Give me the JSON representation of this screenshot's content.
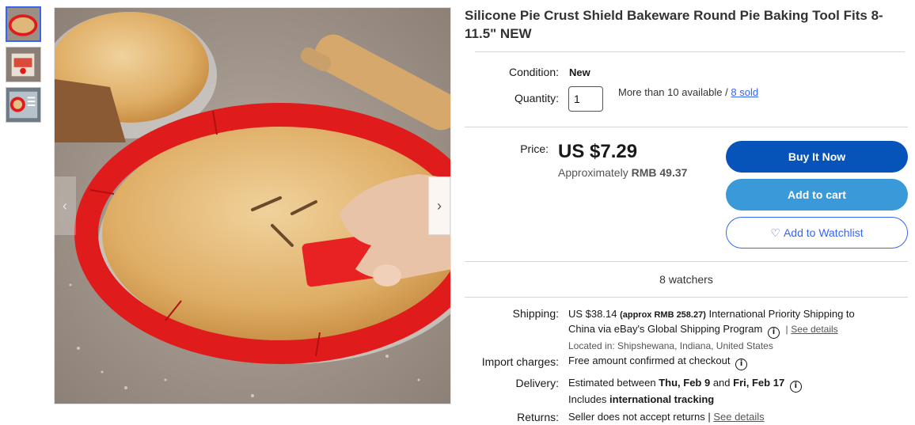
{
  "title": "Silicone Pie Crust Shield Bakeware Round Pie Baking Tool Fits 8-11.5\" NEW",
  "condition": {
    "label": "Condition:",
    "value": "New"
  },
  "quantity": {
    "label": "Quantity:",
    "value": "1",
    "availability": "More than 10 available /",
    "sold": "8 sold"
  },
  "price": {
    "label": "Price:",
    "value": "US $7.29",
    "approx_prefix": "Approximately",
    "approx_value": "RMB 49.37"
  },
  "buttons": {
    "buy_now": "Buy It Now",
    "add_to_cart": "Add to cart",
    "watchlist_icon": "♡",
    "watchlist": "Add to Watchlist"
  },
  "watchers": "8 watchers",
  "shipping": {
    "label": "Shipping:",
    "cost": "US $38.14",
    "approx": "(approx RMB 258.27)",
    "service_line1": "International Priority Shipping to",
    "service_line2": "China via eBay's Global Shipping Program",
    "see_details": "See details",
    "location": "Located in: Shipshewana, Indiana, United States"
  },
  "import_charges": {
    "label": "Import charges:",
    "value": "Free amount confirmed at checkout"
  },
  "delivery": {
    "label": "Delivery:",
    "prefix": "Estimated between",
    "date1": "Thu, Feb 9",
    "and": "and",
    "date2": "Fri, Feb 17",
    "includes": "Includes",
    "tracking": "international tracking"
  },
  "returns": {
    "label": "Returns:",
    "value": "Seller does not accept returns |",
    "see_details": "See details"
  },
  "nav": {
    "prev": "‹",
    "next": "›"
  },
  "colors": {
    "buy_now": "#0654ba",
    "add_to_cart": "#3a9ad9",
    "link": "#3665f3",
    "shield_red": "#e01b1b"
  }
}
